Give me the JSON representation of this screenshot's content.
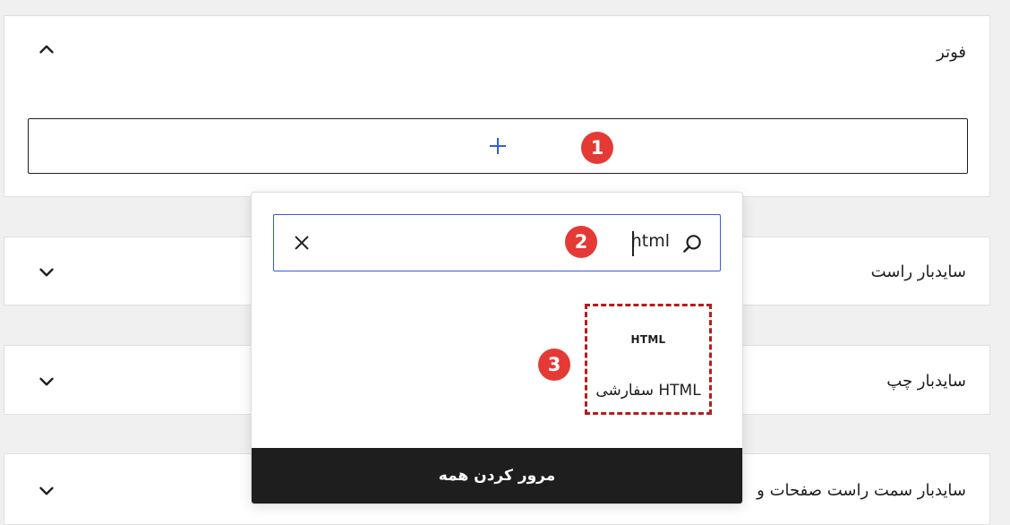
{
  "panels": {
    "footer": {
      "title": "فوتر",
      "expanded": true
    },
    "right_sidebar": {
      "title": "سایدبار راست",
      "expanded": false
    },
    "left_sidebar": {
      "title": "سایدبار چپ",
      "expanded": false
    },
    "right_pages_sidebar": {
      "title": "سایدبار سمت راست صفحات و",
      "expanded": false
    }
  },
  "add_block": {
    "icon": "plus-icon"
  },
  "badges": {
    "b1": "1",
    "b2": "2",
    "b3": "3"
  },
  "inserter": {
    "search_value": "html",
    "result": {
      "icon_text": "HTML",
      "label": "HTML سفارشی"
    },
    "browse_all": "مرور کردن همه"
  },
  "colors": {
    "accent": "#3858e9",
    "badge": "#e53935",
    "highlight_border": "#b71c1c",
    "dark_button": "#1e1e1e"
  }
}
